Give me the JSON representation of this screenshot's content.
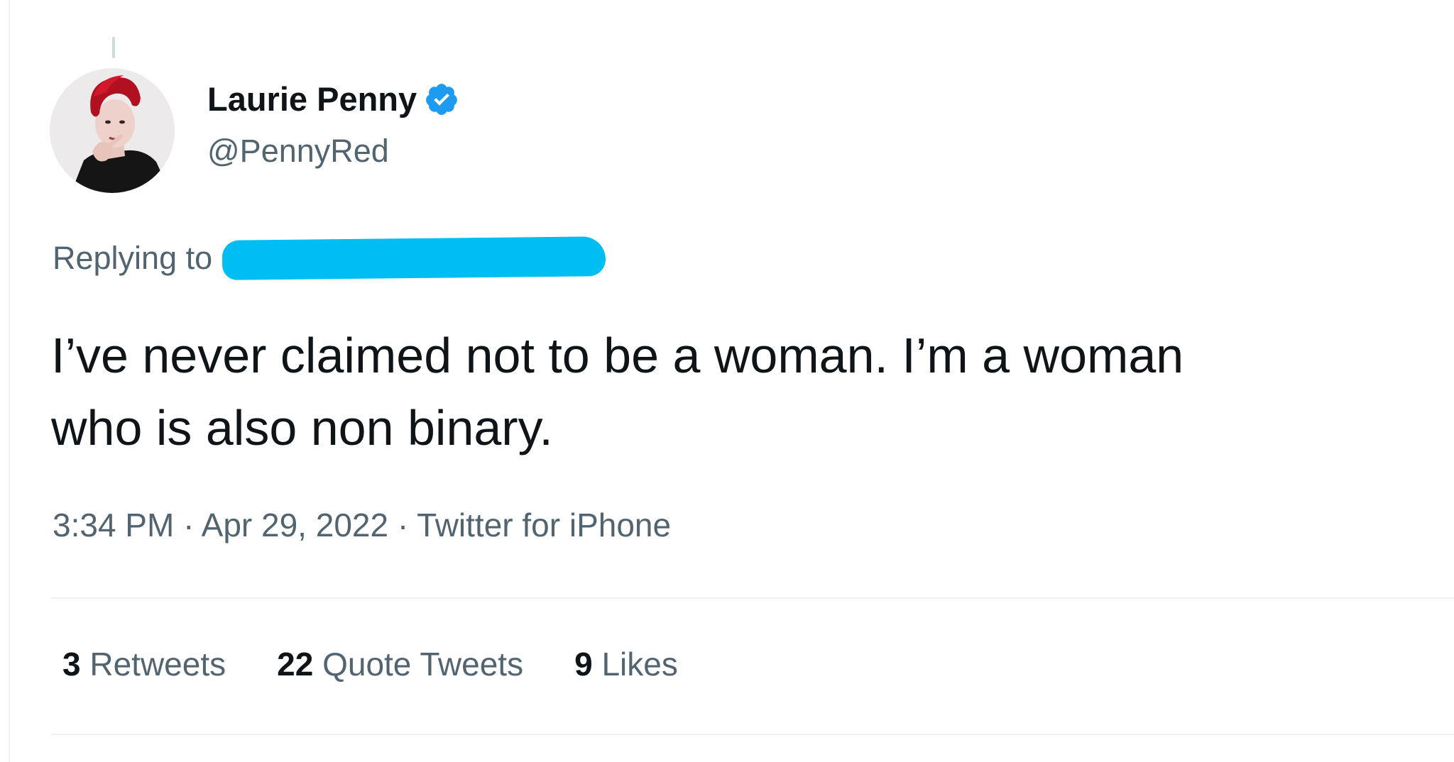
{
  "tweet": {
    "author": {
      "display_name": "Laurie Penny",
      "handle": "@PennyRed",
      "verified": true,
      "avatar_icon": "profile-photo"
    },
    "reply": {
      "label": "Replying to"
    },
    "text_line1": "I’ve never claimed not to be a woman. I’m a woman",
    "text_line2": "who is also non binary.",
    "meta": {
      "time": "3:34 PM",
      "separator1": " · ",
      "date": "Apr 29, 2022",
      "separator2": " · ",
      "source": "Twitter for iPhone"
    },
    "stats": [
      {
        "count": "3",
        "label": "Retweets"
      },
      {
        "count": "22",
        "label": "Quote Tweets"
      },
      {
        "count": "9",
        "label": "Likes"
      }
    ]
  },
  "colors": {
    "text_primary": "#0f1419",
    "text_secondary": "#536471",
    "verified_blue": "#1d9bf0",
    "redaction": "#00bdf2",
    "divider": "#eff3f4"
  }
}
